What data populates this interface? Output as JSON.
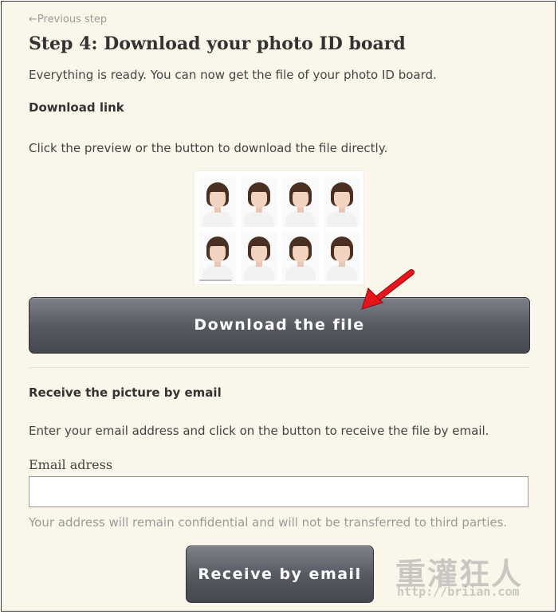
{
  "nav": {
    "previous_step": "←Previous step"
  },
  "step": {
    "title": "Step 4: Download your photo ID board",
    "intro": "Everything is ready. You can now get the file of your photo ID board."
  },
  "download": {
    "heading": "Download link",
    "instructions": "Click the preview or the button to download the file directly.",
    "preview_photo_count": 8,
    "button_label": "Download the file"
  },
  "email": {
    "heading": "Receive the picture by email",
    "instructions": "Enter your email address and click on the button to receive the file by email.",
    "field_label": "Email adress",
    "field_value": "",
    "privacy_note": "Your address will remain confidential and will not be transferred to third parties.",
    "button_label": "Receive by email"
  },
  "watermark": {
    "logo": "重灌狂人",
    "url": "http://briian.com"
  },
  "colors": {
    "page_background": "#faf6ea",
    "button_gradient_top": "#7d8088",
    "button_gradient_bottom": "#45484e",
    "annotation_arrow": "#e8141b"
  },
  "icons": {
    "annotation": "red-arrow-icon"
  }
}
